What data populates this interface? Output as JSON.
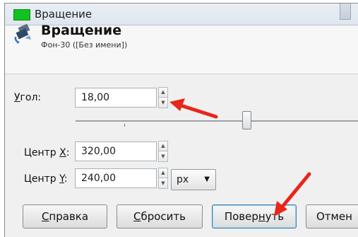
{
  "window": {
    "title": "Вращение",
    "icon": "green-app-icon"
  },
  "header": {
    "title": "Вращение",
    "subtitle": "Фон-30 ([Без имени])",
    "icon": "rotate-tool-icon"
  },
  "angle": {
    "label": "Угол:",
    "mnemonic": "У",
    "label_rest": "гол:",
    "value": "18,00"
  },
  "slider": {
    "value": 18,
    "min": -180,
    "max": 180
  },
  "center_x": {
    "label_prefix": "Центр ",
    "mnemonic": "X",
    "label_suffix": ":",
    "value": "320,00"
  },
  "center_y": {
    "label_prefix": "Центр ",
    "mnemonic": "Y",
    "label_suffix": ":",
    "value": "240,00"
  },
  "unit": {
    "selected": "px"
  },
  "buttons": {
    "help": {
      "mnemonic": "С",
      "rest": "правка"
    },
    "reset": {
      "mnemonic": "С",
      "rest": "бросить"
    },
    "rotate": {
      "before": "Повер",
      "mnemonic": "н",
      "after": "уть"
    },
    "cancel": {
      "label": "Отмен"
    }
  },
  "colors": {
    "annotation_arrow": "#e8261a",
    "app_icon": "#12c21f"
  }
}
